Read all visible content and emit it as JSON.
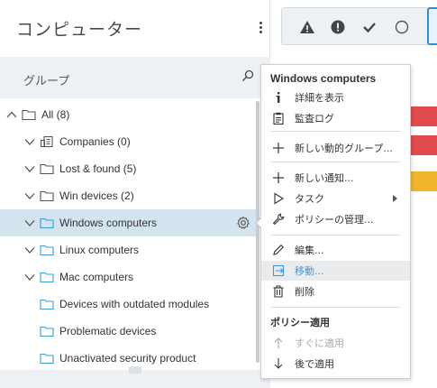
{
  "app": {
    "title": "コンピューター"
  },
  "groups": {
    "header_label": "グループ"
  },
  "tree": [
    {
      "label": "All (8)",
      "indent": 0,
      "icon": "folder-icon",
      "chevron": "up"
    },
    {
      "label": "Companies (0)",
      "indent": 1,
      "icon": "building-icon",
      "chevron": "down"
    },
    {
      "label": "Lost & found (5)",
      "indent": 1,
      "icon": "folder-icon",
      "chevron": "down"
    },
    {
      "label": "Win devices (2)",
      "indent": 1,
      "icon": "folder-icon",
      "chevron": "down"
    },
    {
      "label": "Windows computers",
      "indent": 1,
      "icon": "folder-blue-icon",
      "chevron": "down",
      "selected": true
    },
    {
      "label": "Linux computers",
      "indent": 1,
      "icon": "folder-blue-icon",
      "chevron": "down"
    },
    {
      "label": "Mac computers",
      "indent": 1,
      "icon": "folder-blue-icon",
      "chevron": "down"
    },
    {
      "label": "Devices with outdated modules",
      "indent": 1,
      "icon": "folder-blue-icon",
      "chevron": "none"
    },
    {
      "label": "Problematic devices",
      "indent": 1,
      "icon": "folder-blue-icon",
      "chevron": "none"
    },
    {
      "label": "Unactivated security product",
      "indent": 1,
      "icon": "folder-blue-icon",
      "chevron": "none"
    }
  ],
  "context_menu": {
    "header": "Windows computers",
    "items": [
      {
        "label": "詳細を表示",
        "icon": "info-icon"
      },
      {
        "label": "監査ログ",
        "icon": "clipboard-icon"
      },
      {
        "label": "新しい動的グループ...",
        "icon": "plus-icon"
      },
      {
        "label": "新しい通知...",
        "icon": "plus-icon"
      },
      {
        "label": "タスク",
        "icon": "play-icon"
      },
      {
        "label": "ポリシーの管理...",
        "icon": "wrench-icon"
      },
      {
        "label": "編集...",
        "icon": "pencil-icon"
      },
      {
        "label": "移動...",
        "icon": "move-icon"
      },
      {
        "label": "削除",
        "icon": "trash-icon"
      }
    ],
    "policy_header": "ポリシー適用",
    "policy_items": [
      {
        "label": "すぐに適用",
        "icon": "arrow-up-icon",
        "disabled": true
      },
      {
        "label": "後で適用",
        "icon": "arrow-down-icon",
        "disabled": false
      }
    ]
  },
  "status_filters": [
    {
      "icon": "warning-icon"
    },
    {
      "icon": "error-icon"
    },
    {
      "icon": "check-icon"
    },
    {
      "icon": "circle-icon"
    }
  ],
  "colors": {
    "selected_row": "#d3e4ee",
    "accent": "#2f8fd6",
    "red": "#e14b4b",
    "yellow": "#f0b52c"
  }
}
